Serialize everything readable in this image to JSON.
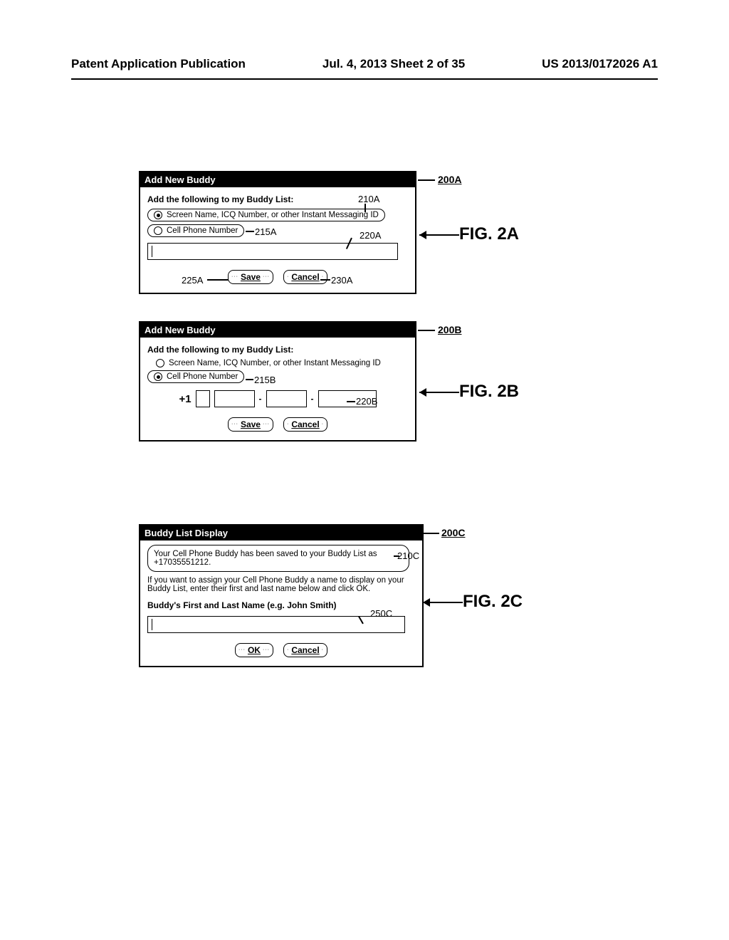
{
  "header": {
    "left": "Patent Application Publication",
    "center": "Jul. 4, 2013   Sheet 2 of 35",
    "right": "US 2013/0172026 A1"
  },
  "fig2a": {
    "num": "200A",
    "label": "FIG. 2A",
    "title": "Add New Buddy",
    "prompt": "Add the following to my Buddy List:",
    "opt1": "Screen Name, ICQ Number, or other Instant Messaging ID",
    "opt2": "Cell Phone Number",
    "save": "Save",
    "cancel": "Cancel",
    "c_210A": "210A",
    "c_215A": "215A",
    "c_220A": "220A",
    "c_225A": "225A",
    "c_230A": "230A"
  },
  "fig2b": {
    "num": "200B",
    "label": "FIG. 2B",
    "title": "Add New Buddy",
    "prompt": "Add the following to my Buddy List:",
    "opt1": "Screen Name, ICQ Number, or other Instant Messaging ID",
    "opt2": "Cell Phone Number",
    "save": "Save",
    "cancel": "Cancel",
    "plus1": "+1",
    "c_215B": "215B",
    "c_220B": "220B"
  },
  "fig2c": {
    "num": "200C",
    "label": "FIG. 2C",
    "title": "Buddy List Display",
    "msg": "Your Cell Phone Buddy has been saved to your Buddy List as +17035551212.",
    "instr": "If you want to assign your Cell Phone Buddy a name to display on your Buddy List, enter their first and last name below and click OK.",
    "name_prompt": "Buddy's First and Last Name (e.g. John Smith)",
    "ok": "OK",
    "cancel": "Cancel",
    "c_210C": "210C",
    "c_250C": "250C"
  }
}
